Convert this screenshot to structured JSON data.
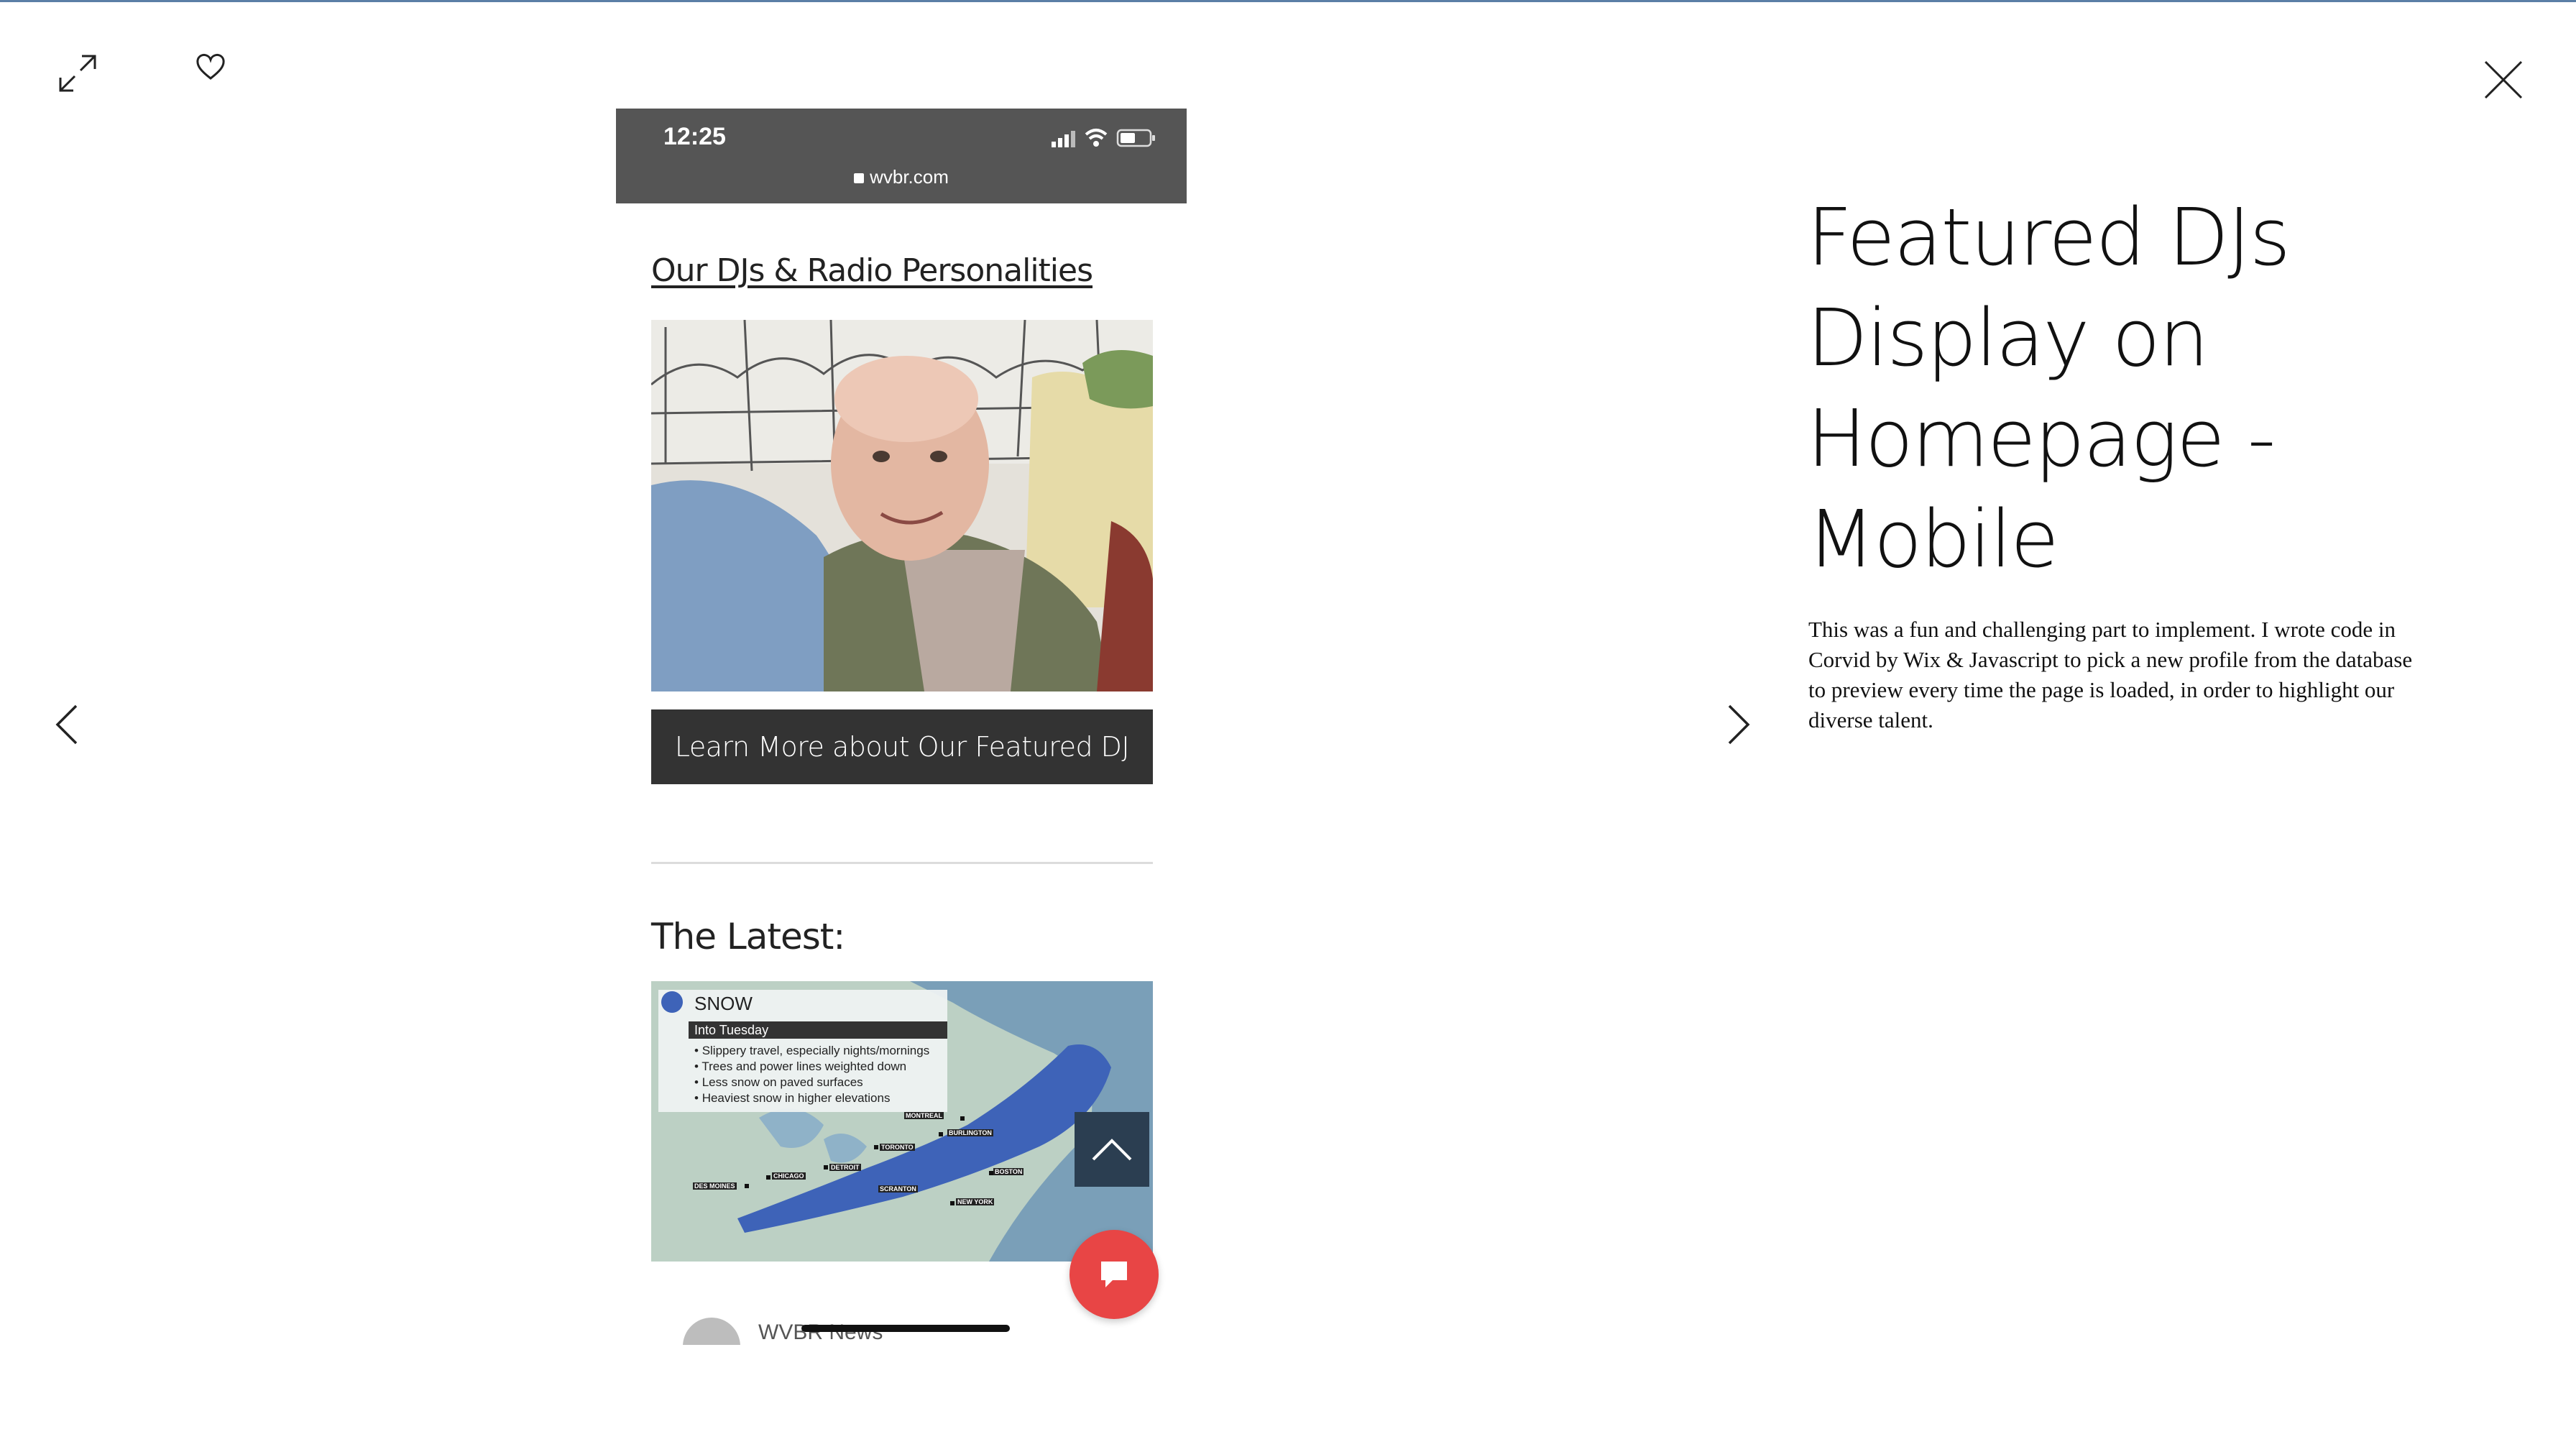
{
  "viewer": {
    "expand_icon": "expand-icon",
    "like_icon": "heart-icon",
    "close_icon": "close-icon",
    "prev_icon": "chevron-left-icon",
    "next_icon": "chevron-right-icon"
  },
  "phone": {
    "status_time": "12:25",
    "url": "wvbr.com",
    "djs_heading": "Our DJs & Radio Personalities",
    "dj_button_label": "Learn More about Our Featured DJ",
    "latest_heading": "The Latest:",
    "weather": {
      "title": "SNOW",
      "subtitle": "Into Tuesday",
      "bullets": [
        "Slippery travel, especially nights/mornings",
        "Trees and power lines weighted down",
        "Less snow on paved surfaces",
        "Heaviest snow in higher elevations"
      ],
      "cities": [
        "MONTREAL",
        "BURLINGTON",
        "TORONTO",
        "DETROIT",
        "CHICAGO",
        "DES MOINES",
        "SCRANTON",
        "BOSTON",
        "NEW YORK"
      ]
    },
    "post_author": "WVBR News",
    "colors": {
      "status_bar": "#555555",
      "button": "#333333",
      "chat_fab": "#e84545",
      "scroll_up": "#2b3e51"
    }
  },
  "panel": {
    "title": "Featured DJs Display on Homepage - Mobile",
    "description": "This was a fun and challenging part to implement. I wrote code in Corvid by Wix & Javascript to pick a new profile from the database to preview every time the page is loaded, in order to highlight our diverse talent."
  }
}
